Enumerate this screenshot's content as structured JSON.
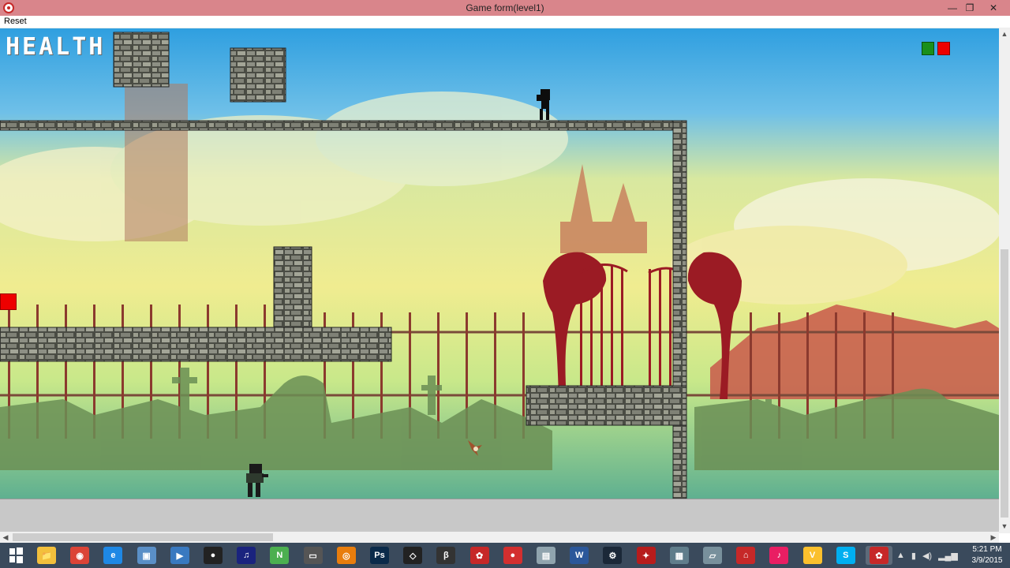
{
  "window": {
    "title": "Game form(level1)",
    "min_glyph": "—",
    "max_glyph": "❐",
    "close_glyph": "✕"
  },
  "menu": {
    "reset_label": "Reset"
  },
  "game": {
    "health_label": "HEALTH",
    "indicator_colors": {
      "green": "#1a8f1a",
      "red": "#e00000"
    }
  },
  "scrollbars": {
    "up_glyph": "▲",
    "down_glyph": "▼",
    "left_glyph": "◀",
    "right_glyph": "▶"
  },
  "taskbar": {
    "icons": [
      {
        "name": "file-explorer-icon",
        "glyph": "📁",
        "bg": "#f3c03c"
      },
      {
        "name": "chrome-icon",
        "glyph": "◉",
        "bg": "#db4437"
      },
      {
        "name": "internet-explorer-icon",
        "glyph": "e",
        "bg": "#1e88e5"
      },
      {
        "name": "remote-desktop-icon",
        "glyph": "▣",
        "bg": "#5a8fc7"
      },
      {
        "name": "media-player-icon",
        "glyph": "▶",
        "bg": "#3979c0"
      },
      {
        "name": "obs-icon",
        "glyph": "●",
        "bg": "#222"
      },
      {
        "name": "headphones-icon",
        "glyph": "♫",
        "bg": "#1a237e"
      },
      {
        "name": "nvidia-icon",
        "glyph": "N",
        "bg": "#4caf50"
      },
      {
        "name": "monitor-icon",
        "glyph": "▭",
        "bg": "#555"
      },
      {
        "name": "blender-icon",
        "glyph": "◎",
        "bg": "#e87d0d"
      },
      {
        "name": "photoshop-icon",
        "glyph": "Ps",
        "bg": "#0a2a4a"
      },
      {
        "name": "unity-icon",
        "glyph": "◇",
        "bg": "#222"
      },
      {
        "name": "beta-icon",
        "glyph": "β",
        "bg": "#333"
      },
      {
        "name": "game-app-icon",
        "glyph": "✿",
        "bg": "#c62828"
      },
      {
        "name": "record-icon",
        "glyph": "●",
        "bg": "#d32f2f"
      },
      {
        "name": "photos-icon",
        "glyph": "▤",
        "bg": "#90a4ae"
      },
      {
        "name": "word-icon",
        "glyph": "W",
        "bg": "#2b579a"
      },
      {
        "name": "steam-icon",
        "glyph": "⚙",
        "bg": "#1b2838"
      },
      {
        "name": "arrows-icon",
        "glyph": "✦",
        "bg": "#b71c1c"
      },
      {
        "name": "calculator-icon",
        "glyph": "▦",
        "bg": "#607d8b"
      },
      {
        "name": "paper-icon",
        "glyph": "▱",
        "bg": "#78909c"
      },
      {
        "name": "museum-icon",
        "glyph": "⌂",
        "bg": "#c62828"
      },
      {
        "name": "itunes-icon",
        "glyph": "♪",
        "bg": "#e91e63"
      },
      {
        "name": "v-app-icon",
        "glyph": "V",
        "bg": "#fbc02d"
      },
      {
        "name": "skype-icon",
        "glyph": "S",
        "bg": "#00aff0"
      },
      {
        "name": "game-form-icon",
        "glyph": "✿",
        "bg": "#c62828",
        "active": true
      }
    ],
    "tray_glyphs": [
      "▲",
      "▮",
      "◀)",
      "▂▄▆"
    ],
    "time": "5:21 PM",
    "date": "3/9/2015"
  }
}
